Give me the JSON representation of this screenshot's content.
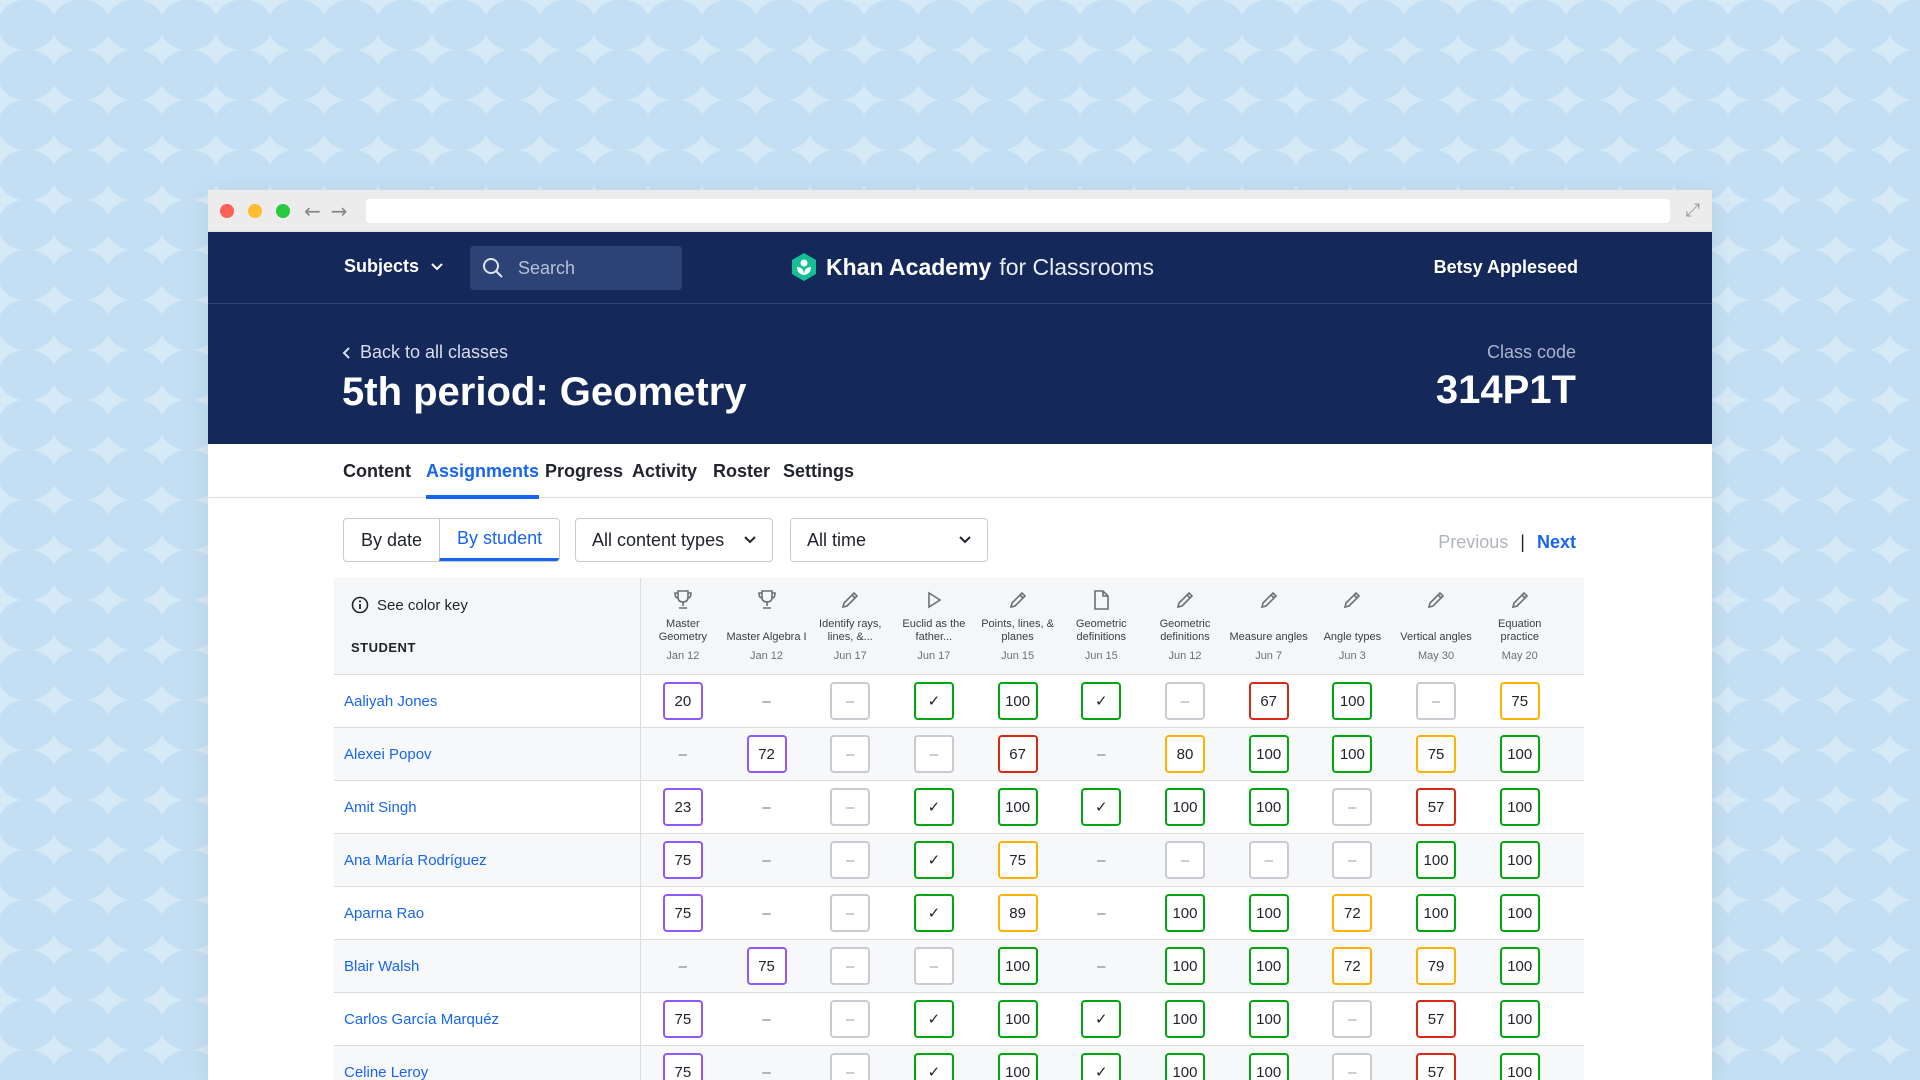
{
  "header": {
    "subjects_label": "Subjects",
    "search_placeholder": "Search",
    "brand_name": "Khan Academy",
    "brand_suffix": "for Classrooms",
    "user_name": "Betsy Appleseed"
  },
  "class": {
    "back_label": "Back to all classes",
    "title": "5th period: Geometry",
    "code_label": "Class code",
    "code": "314P1T"
  },
  "tabs": [
    {
      "label": "Content"
    },
    {
      "label": "Assignments"
    },
    {
      "label": "Progress"
    },
    {
      "label": "Activity"
    },
    {
      "label": "Roster"
    },
    {
      "label": "Settings"
    }
  ],
  "controls": {
    "by_date": "By date",
    "by_student": "By student",
    "content_filter": "All content types",
    "time_filter": "All time",
    "previous": "Previous",
    "separator": "|",
    "next": "Next"
  },
  "grid": {
    "color_key": "See color key",
    "student_header": "STUDENT",
    "assignments": [
      {
        "title": "Master Geometry",
        "date": "Jan 12",
        "icon": "trophy-icon"
      },
      {
        "title": "Master Algebra I",
        "date": "Jan 12",
        "icon": "trophy-icon"
      },
      {
        "title": "Identify rays, lines, &...",
        "date": "Jun 17",
        "icon": "pencil-icon"
      },
      {
        "title": "Euclid as the father...",
        "date": "Jun 17",
        "icon": "play-icon"
      },
      {
        "title": "Points, lines, & planes",
        "date": "Jun 15",
        "icon": "pencil-icon"
      },
      {
        "title": "Geometric definitions",
        "date": "Jun 15",
        "icon": "document-icon"
      },
      {
        "title": "Geometric definitions",
        "date": "Jun 12",
        "icon": "pencil-icon"
      },
      {
        "title": "Measure angles",
        "date": "Jun 7",
        "icon": "pencil-icon"
      },
      {
        "title": "Angle types",
        "date": "Jun 3",
        "icon": "pencil-icon"
      },
      {
        "title": "Vertical angles",
        "date": "May 30",
        "icon": "pencil-icon"
      },
      {
        "title": "Equation practice",
        "date": "May 20",
        "icon": "pencil-icon"
      }
    ],
    "students": [
      {
        "name": "Aaliyah Jones",
        "scores": [
          {
            "v": "20",
            "s": "purple"
          },
          {
            "v": "–",
            "s": "none"
          },
          {
            "v": "–",
            "s": "gray"
          },
          {
            "v": "✓",
            "s": "green"
          },
          {
            "v": "100",
            "s": "green"
          },
          {
            "v": "✓",
            "s": "green"
          },
          {
            "v": "–",
            "s": "gray"
          },
          {
            "v": "67",
            "s": "red"
          },
          {
            "v": "100",
            "s": "green"
          },
          {
            "v": "–",
            "s": "gray"
          },
          {
            "v": "75",
            "s": "yellow"
          }
        ]
      },
      {
        "name": "Alexei Popov",
        "scores": [
          {
            "v": "–",
            "s": "none"
          },
          {
            "v": "72",
            "s": "purple"
          },
          {
            "v": "–",
            "s": "gray"
          },
          {
            "v": "–",
            "s": "gray"
          },
          {
            "v": "67",
            "s": "red"
          },
          {
            "v": "–",
            "s": "none"
          },
          {
            "v": "80",
            "s": "yellow"
          },
          {
            "v": "100",
            "s": "green"
          },
          {
            "v": "100",
            "s": "green"
          },
          {
            "v": "75",
            "s": "yellow"
          },
          {
            "v": "100",
            "s": "green"
          }
        ]
      },
      {
        "name": "Amit Singh",
        "scores": [
          {
            "v": "23",
            "s": "purple"
          },
          {
            "v": "–",
            "s": "none"
          },
          {
            "v": "–",
            "s": "gray"
          },
          {
            "v": "✓",
            "s": "green"
          },
          {
            "v": "100",
            "s": "green"
          },
          {
            "v": "✓",
            "s": "green"
          },
          {
            "v": "100",
            "s": "green"
          },
          {
            "v": "100",
            "s": "green"
          },
          {
            "v": "–",
            "s": "gray"
          },
          {
            "v": "57",
            "s": "red"
          },
          {
            "v": "100",
            "s": "green"
          }
        ]
      },
      {
        "name": "Ana María Rodríguez",
        "scores": [
          {
            "v": "75",
            "s": "purple"
          },
          {
            "v": "–",
            "s": "none"
          },
          {
            "v": "–",
            "s": "gray"
          },
          {
            "v": "✓",
            "s": "green"
          },
          {
            "v": "75",
            "s": "yellow"
          },
          {
            "v": "–",
            "s": "none"
          },
          {
            "v": "–",
            "s": "gray"
          },
          {
            "v": "–",
            "s": "gray"
          },
          {
            "v": "–",
            "s": "gray"
          },
          {
            "v": "100",
            "s": "green"
          },
          {
            "v": "100",
            "s": "green"
          }
        ]
      },
      {
        "name": "Aparna Rao",
        "scores": [
          {
            "v": "75",
            "s": "purple"
          },
          {
            "v": "–",
            "s": "none"
          },
          {
            "v": "–",
            "s": "gray"
          },
          {
            "v": "✓",
            "s": "green"
          },
          {
            "v": "89",
            "s": "yellow"
          },
          {
            "v": "–",
            "s": "none"
          },
          {
            "v": "100",
            "s": "green"
          },
          {
            "v": "100",
            "s": "green"
          },
          {
            "v": "72",
            "s": "yellow"
          },
          {
            "v": "100",
            "s": "green"
          },
          {
            "v": "100",
            "s": "green"
          }
        ]
      },
      {
        "name": "Blair Walsh",
        "scores": [
          {
            "v": "–",
            "s": "none"
          },
          {
            "v": "75",
            "s": "purple"
          },
          {
            "v": "–",
            "s": "gray"
          },
          {
            "v": "–",
            "s": "gray"
          },
          {
            "v": "100",
            "s": "green"
          },
          {
            "v": "–",
            "s": "none"
          },
          {
            "v": "100",
            "s": "green"
          },
          {
            "v": "100",
            "s": "green"
          },
          {
            "v": "72",
            "s": "yellow"
          },
          {
            "v": "79",
            "s": "yellow"
          },
          {
            "v": "100",
            "s": "green"
          }
        ]
      },
      {
        "name": "Carlos García Marquéz",
        "scores": [
          {
            "v": "75",
            "s": "purple"
          },
          {
            "v": "–",
            "s": "none"
          },
          {
            "v": "–",
            "s": "gray"
          },
          {
            "v": "✓",
            "s": "green"
          },
          {
            "v": "100",
            "s": "green"
          },
          {
            "v": "✓",
            "s": "green"
          },
          {
            "v": "100",
            "s": "green"
          },
          {
            "v": "100",
            "s": "green"
          },
          {
            "v": "–",
            "s": "gray"
          },
          {
            "v": "57",
            "s": "red"
          },
          {
            "v": "100",
            "s": "green"
          }
        ]
      },
      {
        "name": "Celine Leroy",
        "scores": [
          {
            "v": "75",
            "s": "purple"
          },
          {
            "v": "–",
            "s": "none"
          },
          {
            "v": "–",
            "s": "gray"
          },
          {
            "v": "✓",
            "s": "green"
          },
          {
            "v": "100",
            "s": "green"
          },
          {
            "v": "✓",
            "s": "green"
          },
          {
            "v": "100",
            "s": "green"
          },
          {
            "v": "100",
            "s": "green"
          },
          {
            "v": "–",
            "s": "gray"
          },
          {
            "v": "57",
            "s": "red"
          },
          {
            "v": "100",
            "s": "green"
          }
        ]
      }
    ]
  },
  "colors": {
    "navy": "#14285a",
    "blue": "#1865f2",
    "green": "#00a60e",
    "yellow": "#ffb100",
    "red": "#d92916",
    "purple": "#9059ff",
    "gray": "#c9cbd0"
  }
}
